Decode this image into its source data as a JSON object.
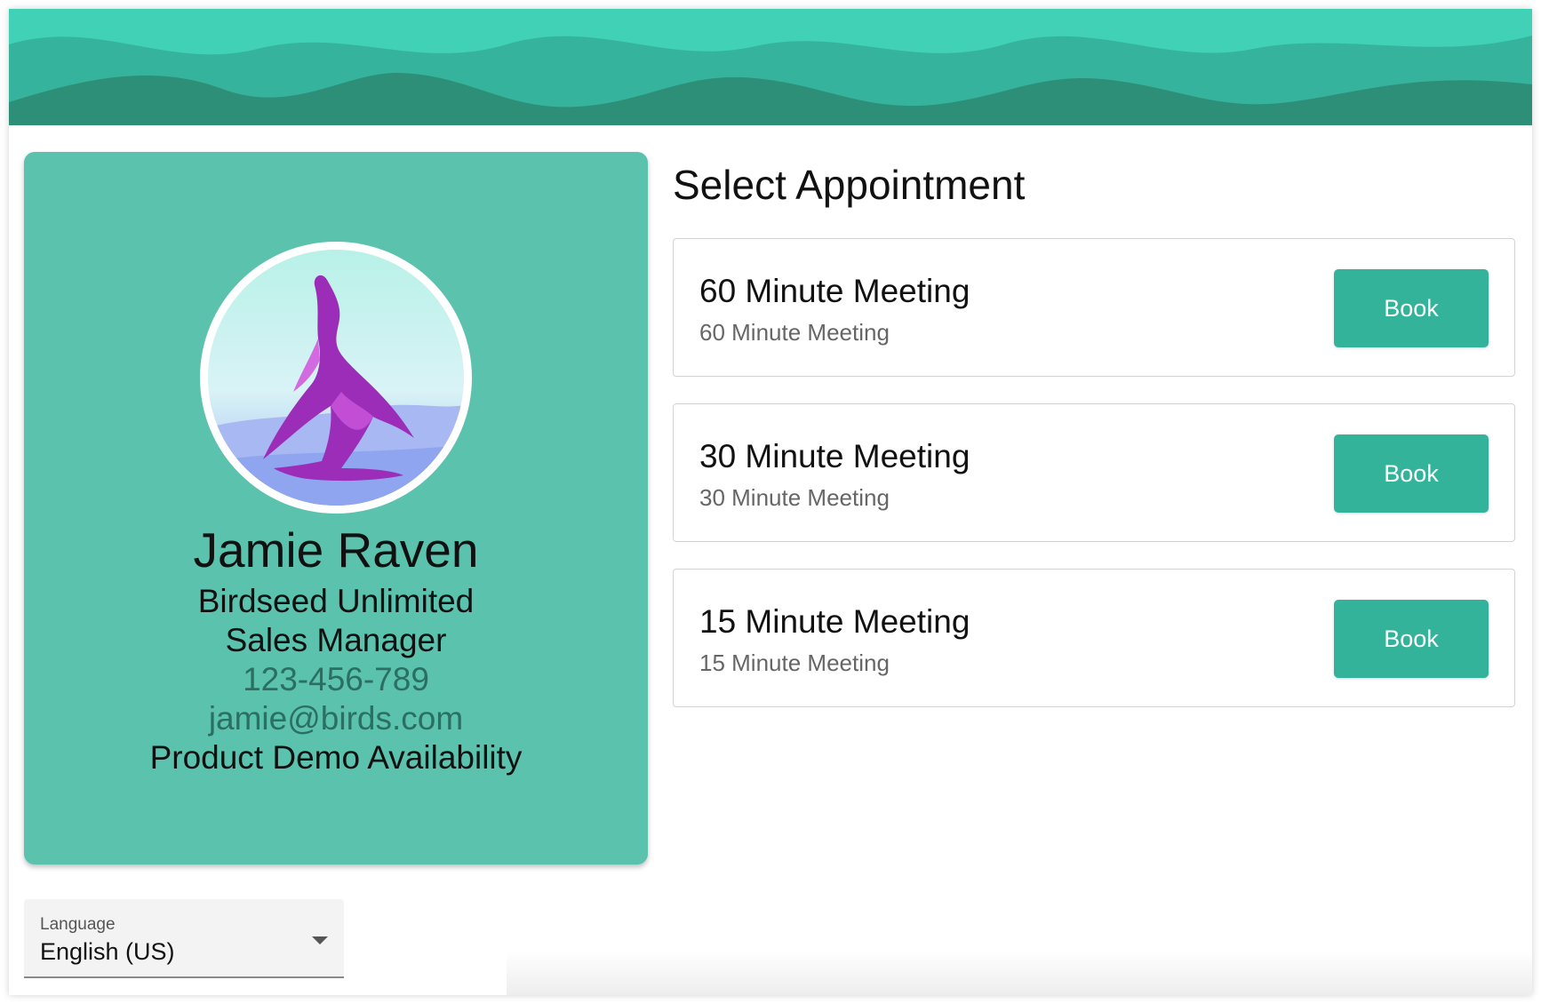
{
  "banner": {
    "colors": {
      "light": "#41d1b6",
      "mid": "#36b39c",
      "dark": "#2d8f78"
    }
  },
  "profile": {
    "avatar_icon": "purple-dragon-icon",
    "name": "Jamie Raven",
    "company": "Birdseed Unlimited",
    "title": "Sales Manager",
    "phone": "123-456-789",
    "email": "jamie@birds.com",
    "event": "Product Demo Availability",
    "card_color": "#5bc2ad"
  },
  "main": {
    "title": "Select Appointment",
    "appointments": [
      {
        "title": "60 Minute Meeting",
        "subtitle": "60 Minute Meeting",
        "button": "Book"
      },
      {
        "title": "30 Minute Meeting",
        "subtitle": "30 Minute Meeting",
        "button": "Book"
      },
      {
        "title": "15 Minute Meeting",
        "subtitle": "15 Minute Meeting",
        "button": "Book"
      }
    ],
    "button_color": "#33b39a"
  },
  "language": {
    "label": "Language",
    "value": "English (US)"
  }
}
